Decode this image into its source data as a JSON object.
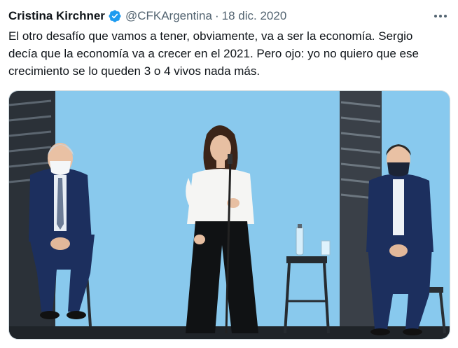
{
  "tweet": {
    "author_name": "Cristina Kirchner",
    "handle": "@CFKArgentina",
    "separator": "·",
    "date": "18 dic. 2020",
    "text": "El otro desafío que vamos a tener, obviamente, va a ser la economía. Sergio decía que la economía va a crecer en el 2021. Pero ojo: yo no quiero que ese crecimiento se lo queden 3 o 4 vivos nada más.",
    "verified_icon": "verified-badge-icon",
    "more_icon": "more-dots-icon"
  },
  "colors": {
    "verified": "#1d9bf0",
    "secondary_text": "#536471",
    "backdrop": "#7fc4ec"
  }
}
